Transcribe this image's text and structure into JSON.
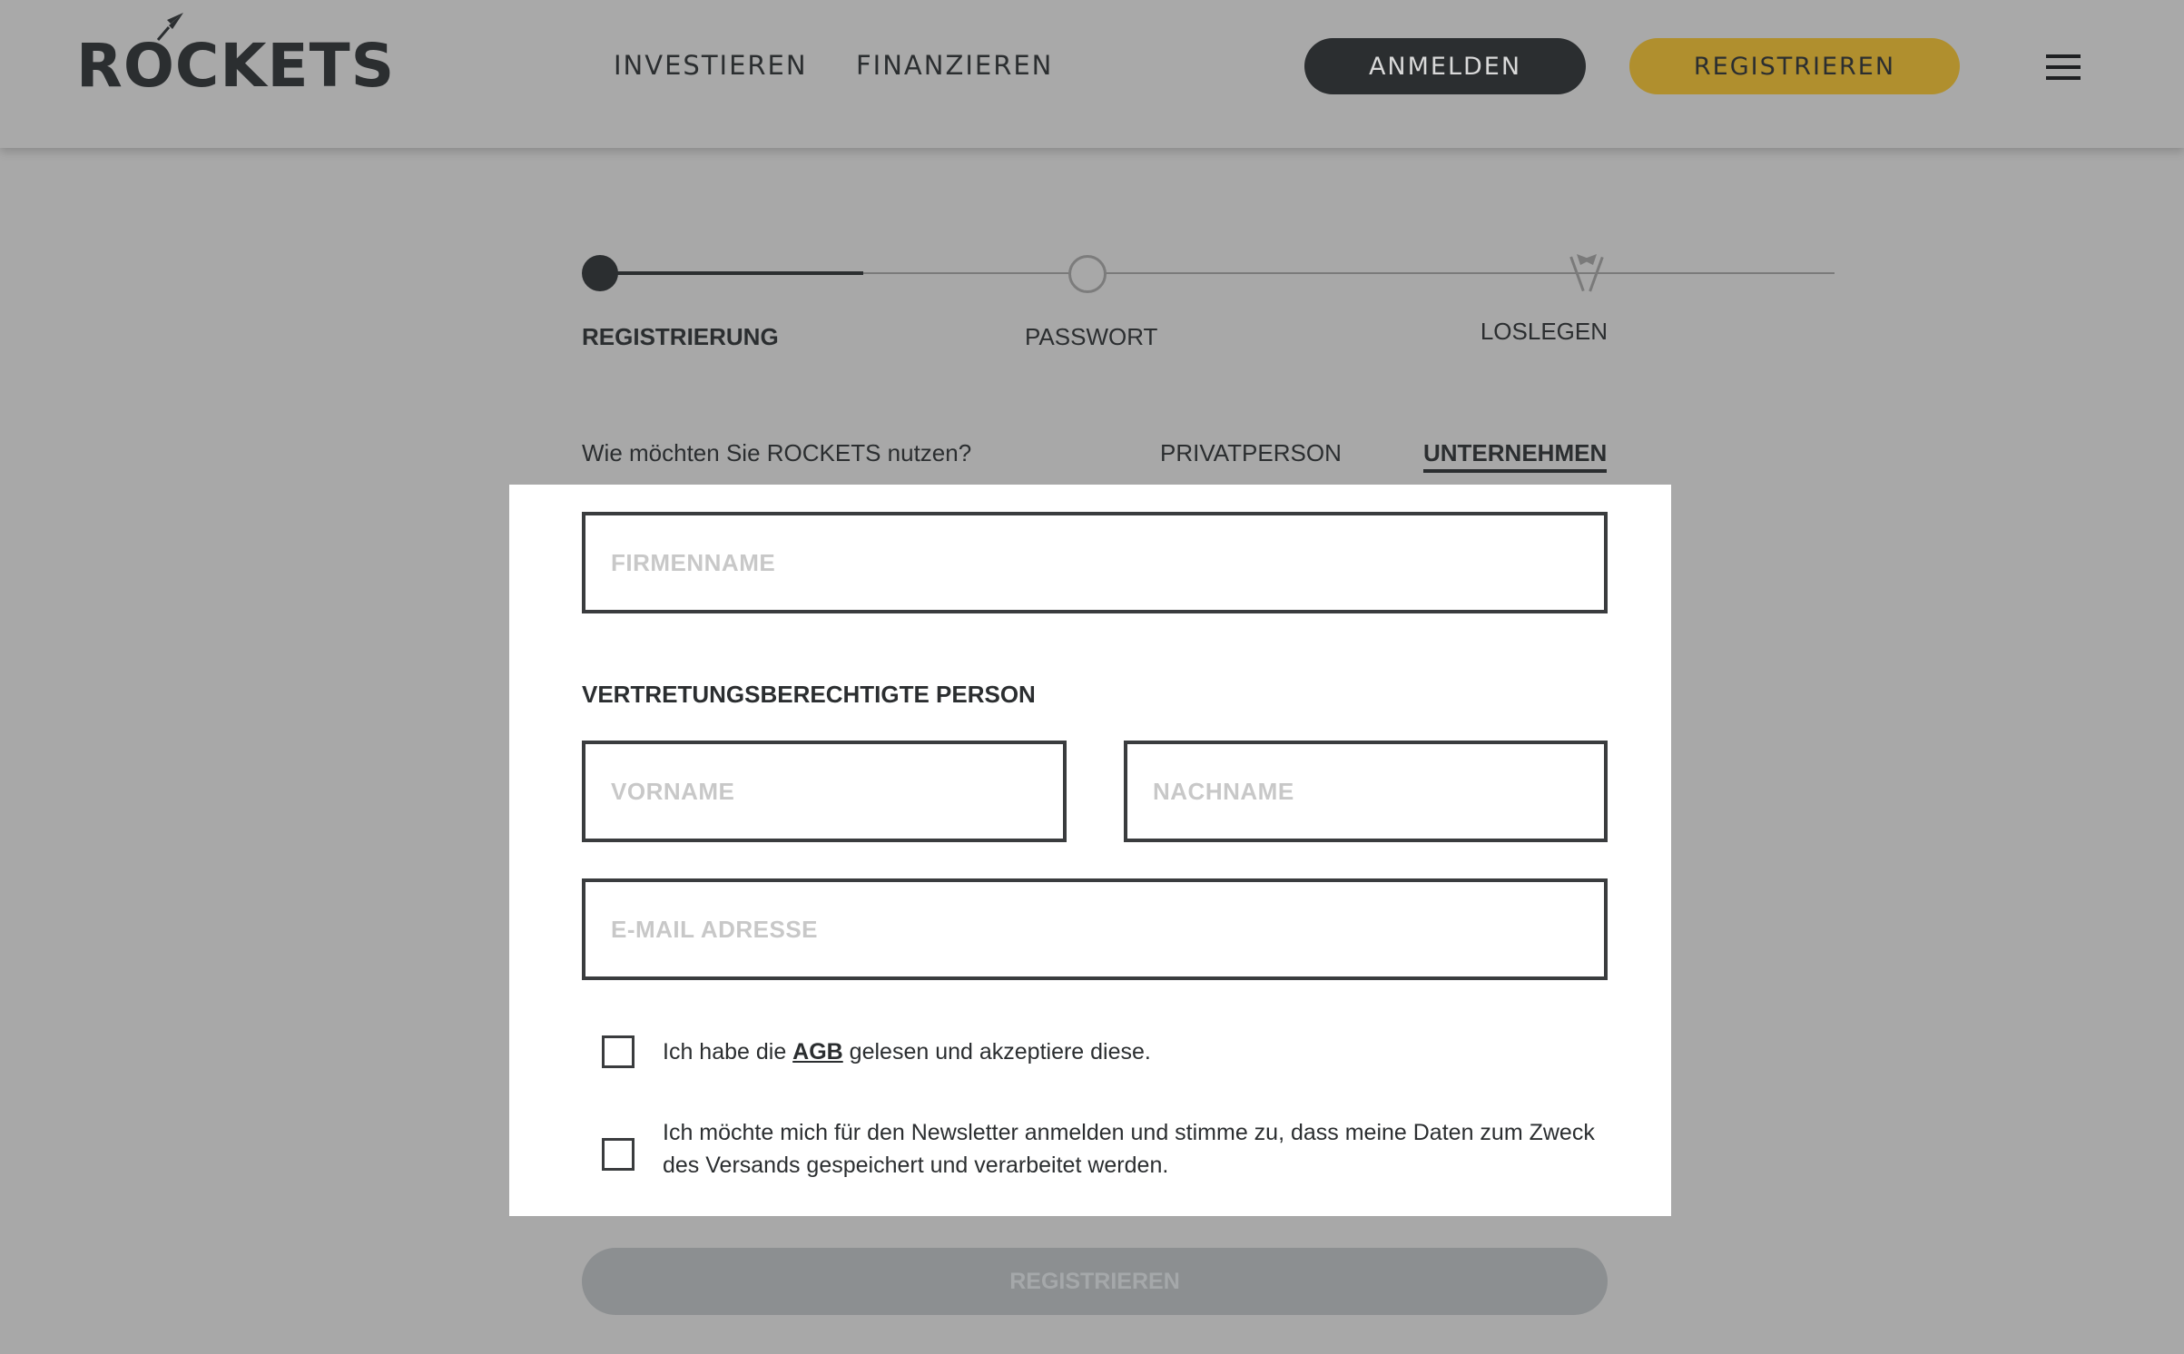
{
  "brand": {
    "logo_text": "ROCKETS"
  },
  "nav": {
    "invest": "INVESTIEREN",
    "finance": "FINANZIEREN",
    "login": "ANMELDEN",
    "register": "REGISTRIEREN",
    "menu_icon": "hamburger-menu-icon"
  },
  "stepper": {
    "steps": [
      {
        "label": "REGISTRIERUNG",
        "state": "active"
      },
      {
        "label": "PASSWORT",
        "state": "pending"
      },
      {
        "label": "LOSLEGEN",
        "state": "final",
        "icon": "flag-icon"
      }
    ]
  },
  "mode": {
    "question": "Wie möchten Sie ROCKETS nutzen?",
    "options": [
      {
        "label": "PRIVATPERSON",
        "selected": false
      },
      {
        "label": "UNTERNEHMEN",
        "selected": true
      }
    ]
  },
  "form": {
    "company_placeholder": "FIRMENNAME",
    "section_title": "VERTRETUNGSBERECHTIGTE PERSON",
    "firstname_placeholder": "VORNAME",
    "lastname_placeholder": "NACHNAME",
    "email_placeholder": "E-MAIL ADRESSE",
    "agb": {
      "before": "Ich habe die ",
      "link": "AGB",
      "after": " gelesen und akzeptiere diese."
    },
    "newsletter": "Ich möchte mich für den Newsletter anmelden und stimme zu, dass meine Daten zum Zweck des Versands gespeichert und verarbeitet werden.",
    "submit": "REGISTRIEREN"
  },
  "colors": {
    "overlay_bg": "#a8a8a8",
    "dark": "#2b2e30",
    "accent_gold": "#b08f2e",
    "submit_disabled": "#8c8f91"
  }
}
